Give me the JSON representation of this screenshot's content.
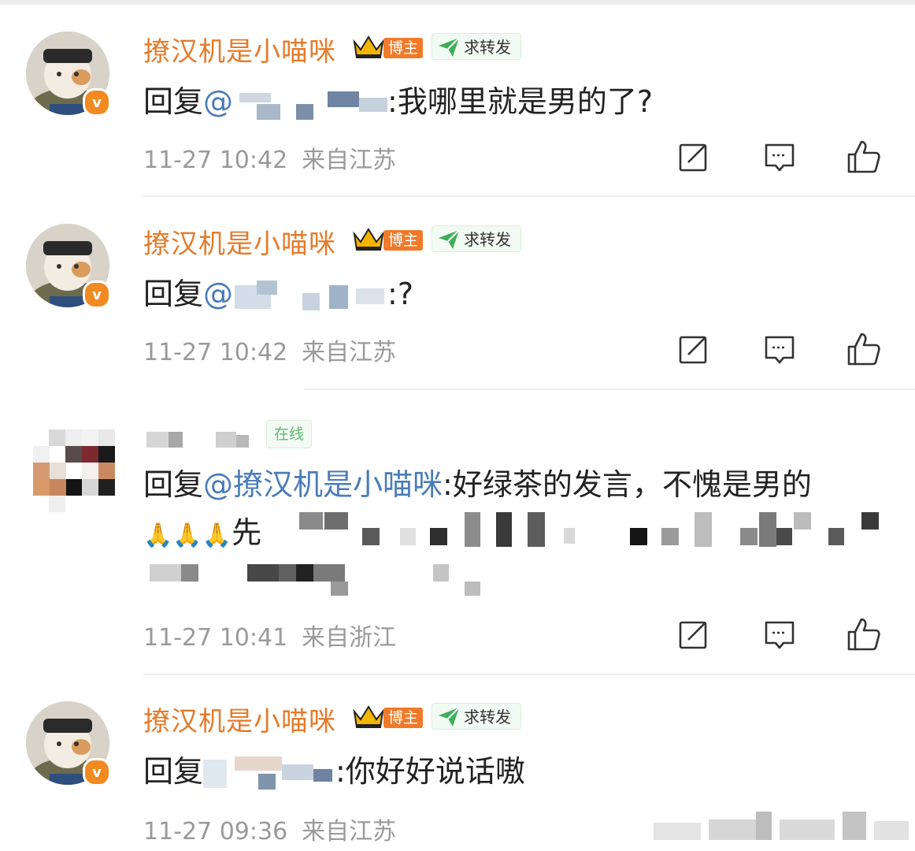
{
  "comments": [
    {
      "username": "撩汉机是小喵咪",
      "blogger_badge": "博主",
      "forward_tag": "求转发",
      "reply_prefix": "回复",
      "mention_at": "@",
      "mention_tail": "",
      "reply_body": ":我哪里就是男的了?",
      "time": "11-27 10:42",
      "location": "来自江苏"
    },
    {
      "username": "撩汉机是小喵咪",
      "blogger_badge": "博主",
      "forward_tag": "求转发",
      "reply_prefix": "回复",
      "mention_at": "@",
      "mention_tail": "",
      "reply_body": ":?",
      "time": "11-27 10:42",
      "location": "来自江苏"
    },
    {
      "online_tag": "在线",
      "reply_prefix": "回复",
      "mention": "@撩汉机是小喵咪",
      "reply_body": ":好绿茶的发言，不愧是男的",
      "line2_emoji": "🙏🙏🙏",
      "line2_text": "先",
      "time": "11-27 10:41",
      "location": "来自浙江"
    },
    {
      "username": "撩汉机是小喵咪",
      "blogger_badge": "博主",
      "forward_tag": "求转发",
      "reply_prefix": "回复",
      "mention_at": "",
      "reply_body": ":你好好说话嗷",
      "time": "11-27 09:36",
      "location": "来自江苏"
    }
  ],
  "actions": [
    "edit-icon",
    "comment-icon",
    "like-icon"
  ],
  "colors": {
    "username": "#e47b2a",
    "mention": "#4a7cb8",
    "meta": "#9a9a9a",
    "badge_orange": "#f07a2a",
    "forward_green": "#3fae5a",
    "verified_orange": "#f08a21"
  }
}
